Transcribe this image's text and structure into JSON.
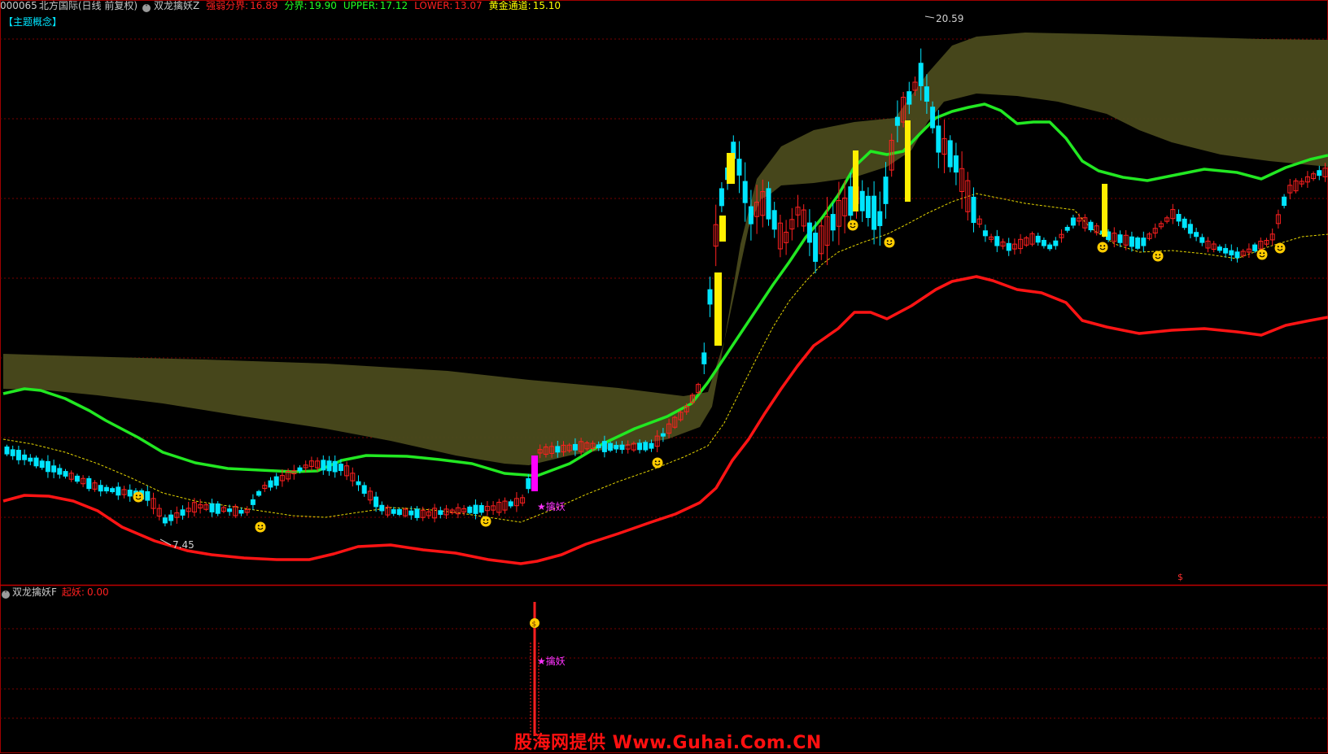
{
  "header": {
    "code": "000065",
    "name": "北方国际",
    "period": "(日线 前复权)",
    "indicator": "双龙擒妖Z",
    "items": [
      {
        "label": "强弱分界:",
        "value": "16.89",
        "color": "#ff2020"
      },
      {
        "label": "分界:",
        "value": "19.90",
        "color": "#22ff22"
      },
      {
        "label": "UPPER:",
        "value": "17.12",
        "color": "#22ff22"
      },
      {
        "label": "LOWER:",
        "value": "13.07",
        "color": "#ff2020"
      },
      {
        "label": "黄金通道:",
        "value": "15.10",
        "color": "#ffff00"
      }
    ]
  },
  "concept_tag": "【主题概念】",
  "annotations": {
    "high_label": "20.59",
    "low_label": "7.45",
    "signal_label": "★擒妖",
    "sub_signal_label": "★擒妖",
    "dollar_mark": "$"
  },
  "sub_header": {
    "indicator": "双龙擒妖F",
    "item_label": "起妖:",
    "item_value": "0.00"
  },
  "watermark": "股海网提供 Www.Guhai.Com.CN",
  "colors": {
    "up": "#ff2020",
    "down": "#00e5ff",
    "green_line": "#22e822",
    "red_line": "#ff1414",
    "band": "#4a4a1c",
    "grid": "#7a0000",
    "yellow": "#ffee00",
    "magenta": "#ff00ff"
  }
}
